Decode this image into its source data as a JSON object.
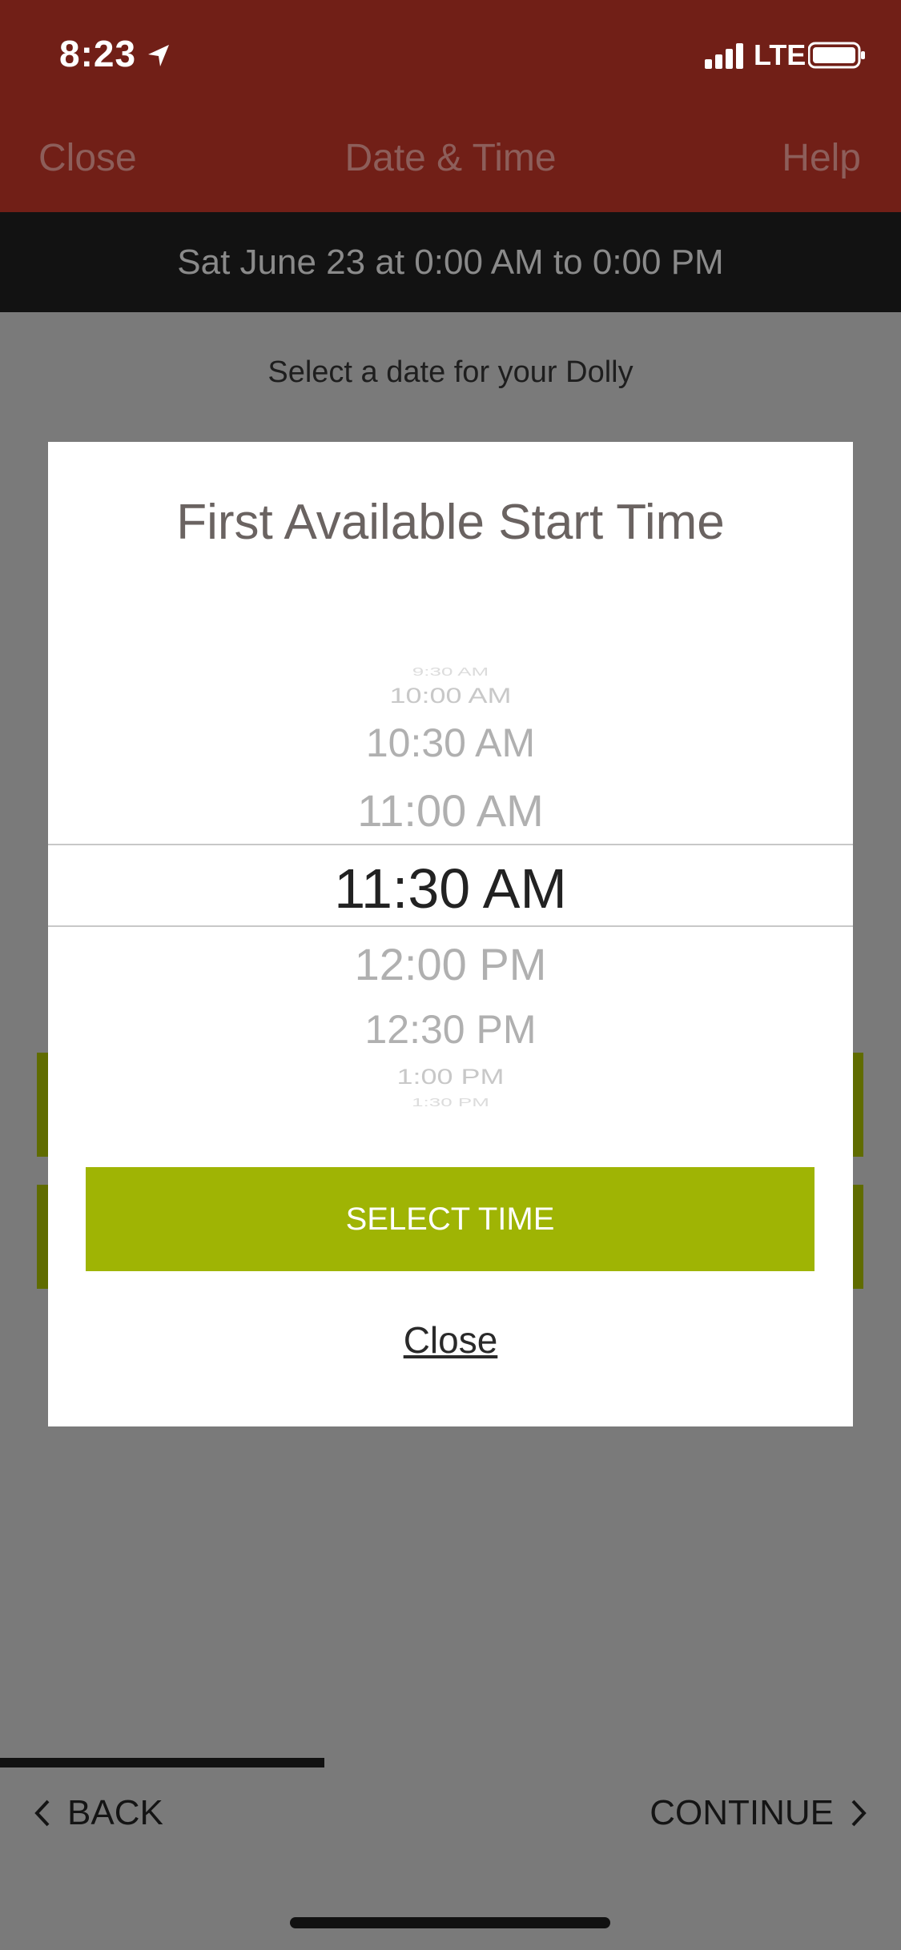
{
  "status": {
    "time": "8:23",
    "network": "LTE"
  },
  "nav": {
    "close": "Close",
    "title": "Date & Time",
    "help": "Help"
  },
  "banner": {
    "text": "Sat June 23 at 0:00 AM to 0:00 PM"
  },
  "page": {
    "subtitle": "Select a date for your Dolly"
  },
  "modal": {
    "title": "First Available Start Time",
    "picker": {
      "items": [
        "9:30 AM",
        "10:00 AM",
        "10:30 AM",
        "11:00 AM",
        "11:30 AM",
        "12:00 PM",
        "12:30 PM",
        "1:00 PM",
        "1:30 PM"
      ],
      "selected": "11:30 AM"
    },
    "select_button": "SELECT TIME",
    "close_link": "Close"
  },
  "footer": {
    "back": "BACK",
    "continue": "CONTINUE",
    "progress_percent": 55
  },
  "colors": {
    "header": "#711f17",
    "accent": "#9fb404",
    "overlay": "#7a7a7a"
  }
}
